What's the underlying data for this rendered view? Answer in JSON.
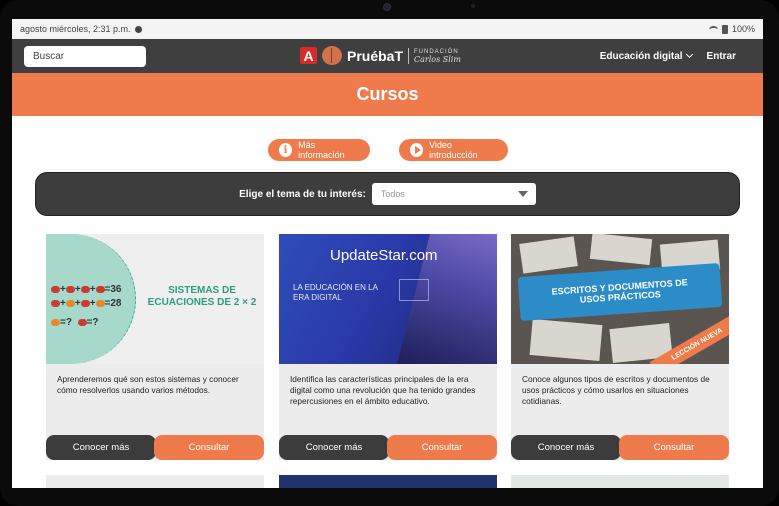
{
  "status": {
    "time": "agosto miércoles, 2:31 p.m.",
    "battery": "100%"
  },
  "nav": {
    "search_placeholder": "Buscar",
    "brand_name": "PruébaT",
    "fund_line1": "FUNDACIÓN",
    "fund_line2": "Carlos Slim",
    "menu_digital": "Educación digital",
    "login": "Entrar"
  },
  "hero": {
    "title": "Cursos"
  },
  "actions": {
    "more_info": "Más información",
    "video_intro": "Video introducción"
  },
  "filter": {
    "label": "Elige el tema de tu interés:",
    "selected": "Todos"
  },
  "cards": [
    {
      "thumb_title": "SISTEMAS DE ECUACIONES DE 2 × 2",
      "eq1": "=36",
      "eq2": "=28",
      "eq3": "=?",
      "eq4": "=?",
      "description": "Aprenderemos qué son estos sistemas y conocer cómo resolverlos usando varios métodos.",
      "btn_more": "Conocer más",
      "btn_consult": "Consultar"
    },
    {
      "watermark": "UpdateStar.com",
      "thumb_title": "LA EDUCACIÓN EN LA ERA DIGITAL",
      "description": "Identifica las características principales de la era digital como una revolución que ha tenido grandes repercusiones en el ámbito educativo.",
      "btn_more": "Conocer más",
      "btn_consult": "Consultar"
    },
    {
      "thumb_title": "ESCRITOS Y DOCUMENTOS DE USOS PRÁCTICOS",
      "ribbon": "LECCIÓN NUEVA",
      "description": "Conoce algunos tipos de escritos y documentos de usos prácticos y cómo usarlos en situaciones cotidianas.",
      "btn_more": "Conocer más",
      "btn_consult": "Consultar"
    }
  ],
  "colors": {
    "accent": "#ef7a4b",
    "nav_bg": "#3f3f3f",
    "teal": "#2e9c81"
  }
}
